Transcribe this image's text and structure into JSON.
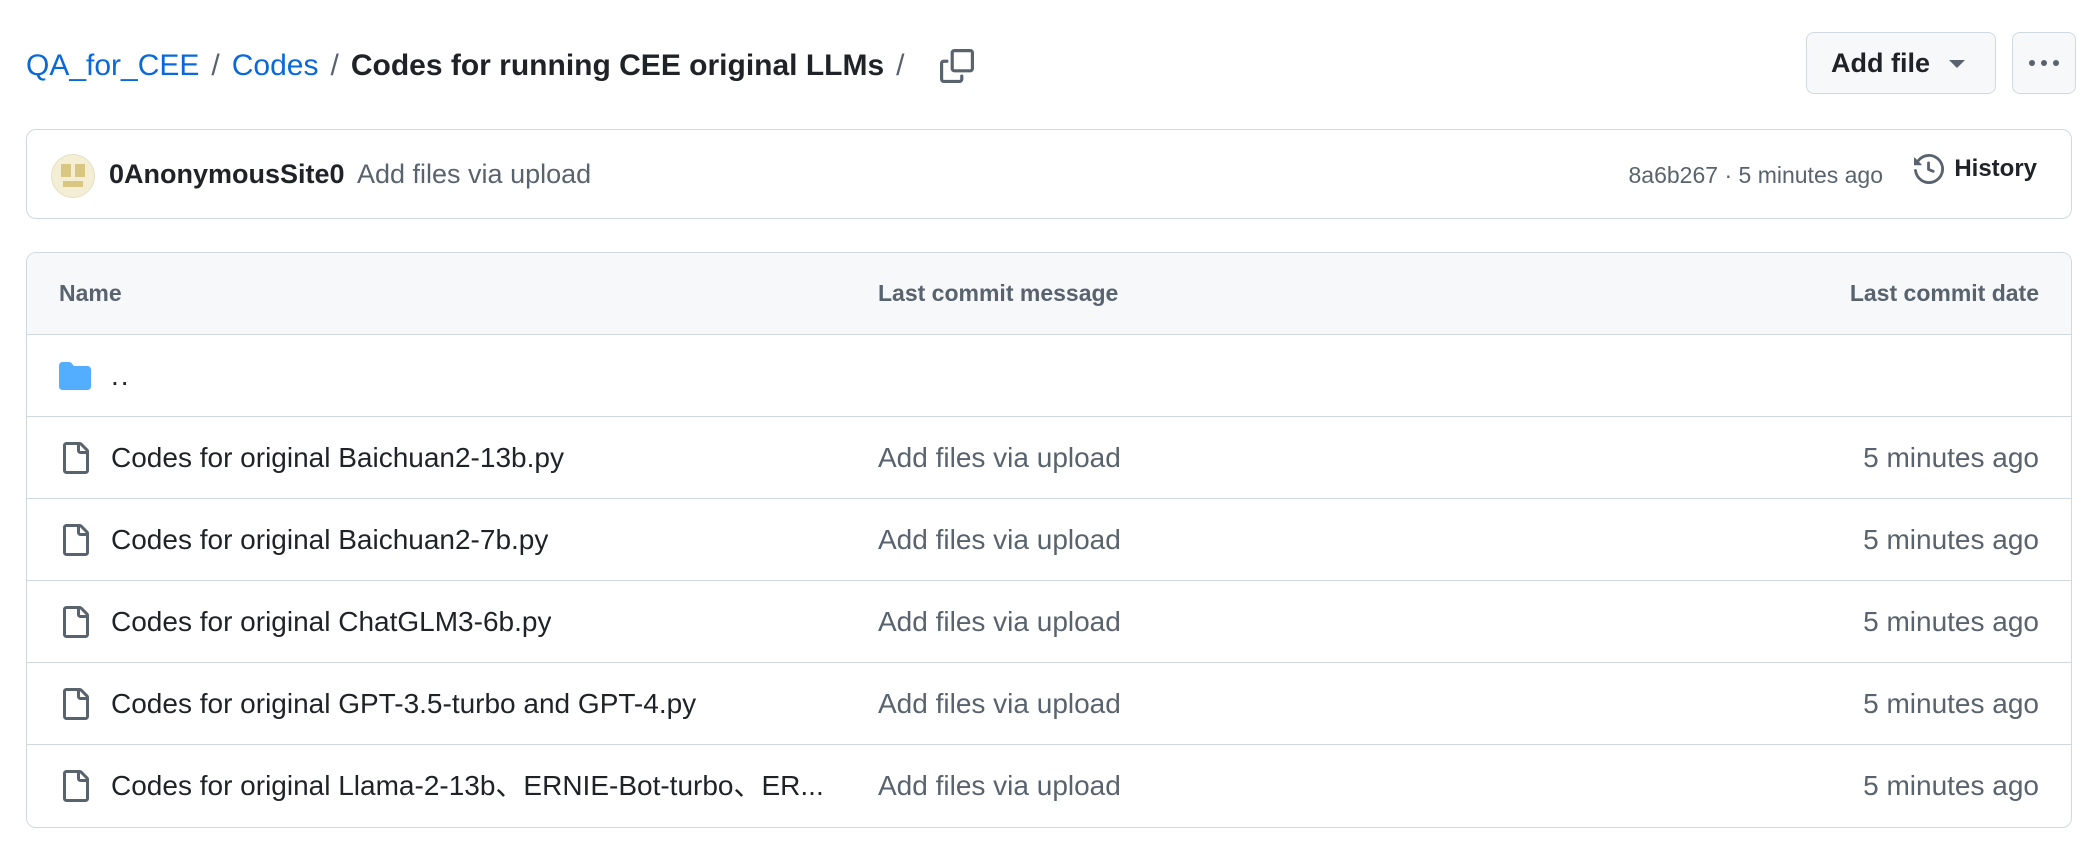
{
  "breadcrumb": {
    "repo": "QA_for_CEE",
    "sep1": "/",
    "folder": "Codes",
    "sep2": "/",
    "current": "Codes for running CEE original LLMs",
    "sep3": "/"
  },
  "actions": {
    "add_file_label": "Add file",
    "more_icon": "kebab-horizontal-icon",
    "copy_icon": "copy-icon"
  },
  "latest_commit": {
    "author": "0AnonymousSite0",
    "message": "Add files via upload",
    "sha": "8a6b267",
    "separator": "·",
    "time": "5 minutes ago",
    "history_label": "History"
  },
  "table": {
    "headers": {
      "name": "Name",
      "message": "Last commit message",
      "date": "Last commit date"
    },
    "parent_dir": "..",
    "files": [
      {
        "name": "Codes for original Baichuan2-13b.py",
        "message": "Add files via upload",
        "date": "5 minutes ago"
      },
      {
        "name": "Codes for original Baichuan2-7b.py",
        "message": "Add files via upload",
        "date": "5 minutes ago"
      },
      {
        "name": "Codes for original ChatGLM3-6b.py",
        "message": "Add files via upload",
        "date": "5 minutes ago"
      },
      {
        "name": "Codes for original GPT-3.5-turbo and GPT-4.py",
        "message": "Add files via upload",
        "date": "5 minutes ago"
      },
      {
        "name": "Codes for original Llama-2-13b、ERNIE-Bot-turbo、ER...",
        "message": "Add files via upload",
        "date": "5 minutes ago"
      }
    ]
  },
  "colors": {
    "link": "#0969da",
    "text": "#1f2328",
    "muted": "#59636e",
    "border": "#d1d9e0",
    "header_bg": "#f6f8fa",
    "folder": "#54aeff"
  }
}
